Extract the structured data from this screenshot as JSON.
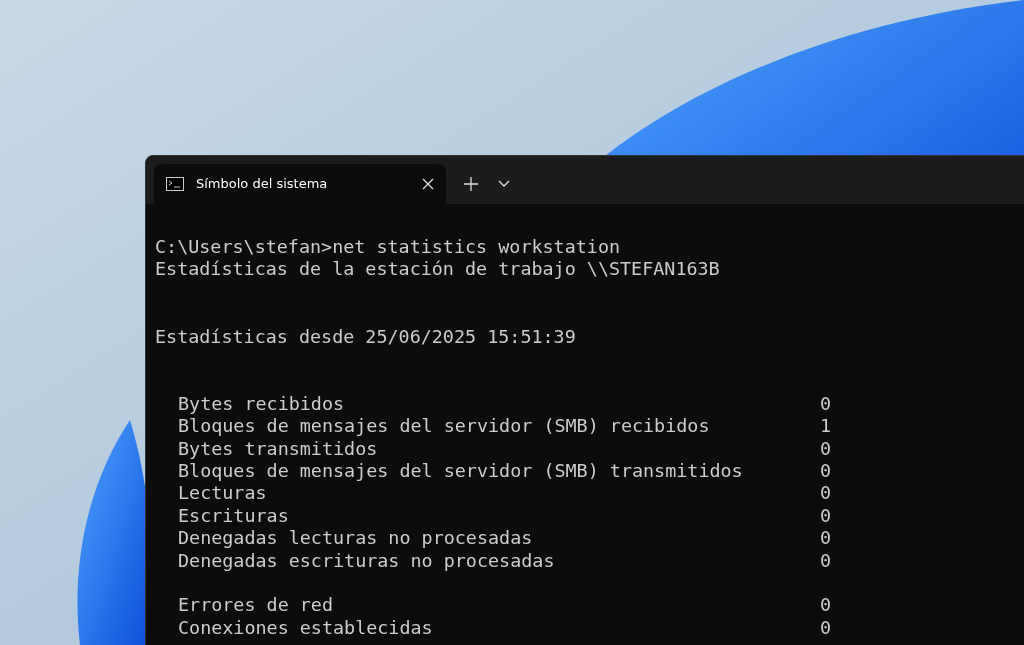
{
  "window": {
    "tab": {
      "title": "Símbolo del sistema",
      "selected": true
    }
  },
  "console": {
    "command": "C:\\Users\\stefan>net statistics workstation",
    "heading": "Estadísticas de la estación de trabajo \\\\STEFAN163B",
    "since": "Estadísticas desde 25/06/2025 15:51:39",
    "groups": [
      [
        {
          "label": "Bytes recibidos",
          "value": "0"
        },
        {
          "label": "Bloques de mensajes del servidor (SMB) recibidos",
          "value": "1"
        },
        {
          "label": "Bytes transmitidos",
          "value": "0"
        },
        {
          "label": "Bloques de mensajes del servidor (SMB) transmitidos",
          "value": "0"
        },
        {
          "label": "Lecturas",
          "value": "0"
        },
        {
          "label": "Escrituras",
          "value": "0"
        },
        {
          "label": "Denegadas lecturas no procesadas",
          "value": "0"
        },
        {
          "label": "Denegadas escrituras no procesadas",
          "value": "0"
        }
      ],
      [
        {
          "label": "Errores de red",
          "value": "0"
        },
        {
          "label": "Conexiones establecidas",
          "value": "0"
        }
      ]
    ]
  }
}
